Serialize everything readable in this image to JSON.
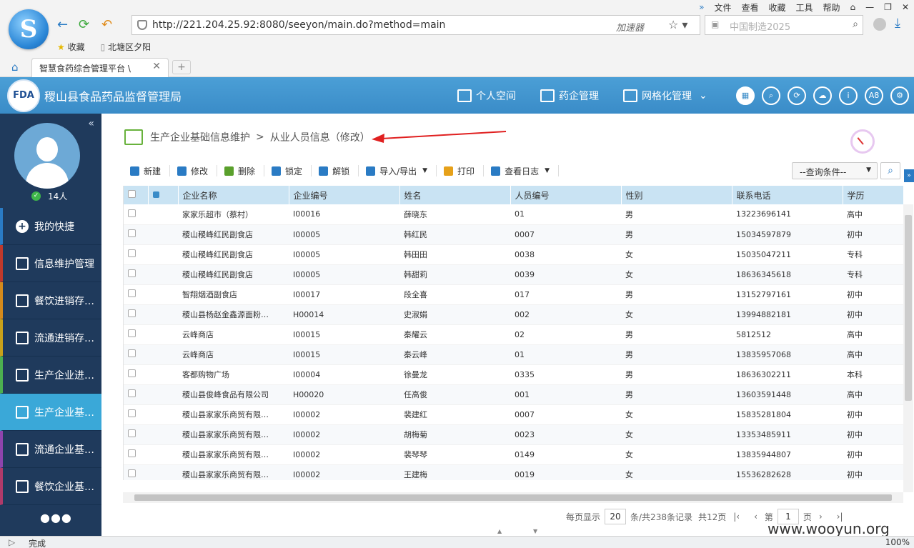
{
  "browser": {
    "menu": [
      "文件",
      "查看",
      "收藏",
      "工具",
      "帮助"
    ],
    "url": "http://221.204.25.92:8080/seeyon/main.do?method=main",
    "accelerator": "加速器",
    "search_placeholder": "中国制造2025",
    "bookmarks": [
      "收藏",
      "北塘区夕阳"
    ],
    "tab_title": "智慧食药综合管理平台 \\",
    "new_tab": "+",
    "logo_glyph": "S"
  },
  "header": {
    "logo_text": "FDA",
    "title": "稷山县食品药品监督管理局",
    "nav": [
      "个人空间",
      "药企管理",
      "网格化管理"
    ],
    "round_icons": [
      "A8"
    ]
  },
  "sidebar": {
    "online_count": "14人",
    "items": [
      {
        "label": "我的快捷",
        "color": "#2a7bc4"
      },
      {
        "label": "信息维护管理",
        "color": "#c0392b"
      },
      {
        "label": "餐饮进销存…",
        "color": "#d48a1c"
      },
      {
        "label": "流通进销存…",
        "color": "#c9a11a"
      },
      {
        "label": "生产企业进…",
        "color": "#4caf50"
      },
      {
        "label": "生产企业基…",
        "color": "#3aa8d8"
      },
      {
        "label": "流通企业基…",
        "color": "#8e44ad"
      },
      {
        "label": "餐饮企业基…",
        "color": "#b03a6a"
      }
    ],
    "more": "●●●"
  },
  "breadcrumb": {
    "parent": "生产企业基础信息维护",
    "separator": ">",
    "current": "从业人员信息（修改）"
  },
  "toolbar": {
    "buttons": [
      {
        "label": "新建",
        "color": "#2a7bc4"
      },
      {
        "label": "修改",
        "color": "#2a7bc4"
      },
      {
        "label": "删除",
        "color": "#5aa02c"
      },
      {
        "label": "锁定",
        "color": "#2a7bc4"
      },
      {
        "label": "解锁",
        "color": "#2a7bc4"
      },
      {
        "label": "导入/导出",
        "color": "#2a7bc4"
      },
      {
        "label": "打印",
        "color": "#e6a11a"
      },
      {
        "label": "查看日志",
        "color": "#2a7bc4"
      }
    ],
    "query_select": "--查询条件--"
  },
  "table": {
    "columns": [
      "企业名称",
      "企业编号",
      "姓名",
      "人员编号",
      "性别",
      "联系电话",
      "学历"
    ],
    "rows": [
      [
        "家家乐超市（蔡村）",
        "I00016",
        "薛晓东",
        "01",
        "男",
        "13223696141",
        "高中"
      ],
      [
        "稷山稷峰红民副食店",
        "I00005",
        "韩红民",
        "0007",
        "男",
        "15034597879",
        "初中"
      ],
      [
        "稷山稷峰红民副食店",
        "I00005",
        "韩田田",
        "0038",
        "女",
        "15035047211",
        "专科"
      ],
      [
        "稷山稷峰红民副食店",
        "I00005",
        "韩甜莉",
        "0039",
        "女",
        "18636345618",
        "专科"
      ],
      [
        "智翔烟酒副食店",
        "I00017",
        "段全喜",
        "017",
        "男",
        "13152797161",
        "初中"
      ],
      [
        "稷山县杨赵金鑫源面粉…",
        "H00014",
        "史淑娟",
        "002",
        "女",
        "13994882181",
        "初中"
      ],
      [
        "云峰商店",
        "I00015",
        "秦耀云",
        "02",
        "男",
        "5812512",
        "高中"
      ],
      [
        "云峰商店",
        "I00015",
        "秦云峰",
        "01",
        "男",
        "13835957068",
        "高中"
      ],
      [
        "客都购物广场",
        "I00004",
        "徐曼龙",
        "0335",
        "男",
        "18636302211",
        "本科"
      ],
      [
        "稷山县俊峰食品有限公司",
        "H00020",
        "任高俊",
        "001",
        "男",
        "13603591448",
        "高中"
      ],
      [
        "稷山县家家乐商贸有限…",
        "I00002",
        "裴建红",
        "0007",
        "女",
        "15835281804",
        "初中"
      ],
      [
        "稷山县家家乐商贸有限…",
        "I00002",
        "胡梅菊",
        "0023",
        "女",
        "13353485911",
        "初中"
      ],
      [
        "稷山县家家乐商贸有限…",
        "I00002",
        "裴琴琴",
        "0149",
        "女",
        "13835944807",
        "初中"
      ],
      [
        "稷山县家家乐商贸有限…",
        "I00002",
        "王建梅",
        "0019",
        "女",
        "15536282628",
        "初中"
      ]
    ]
  },
  "pager": {
    "per_page_label": "每页显示",
    "per_page": "20",
    "total_label": "条/共238条记录",
    "pages_label": "共12页",
    "page_prefix": "第",
    "page": "1",
    "page_suffix": "页"
  },
  "status": {
    "text": "完成",
    "zoom": "100%"
  },
  "watermark": "www.wooyun.org"
}
